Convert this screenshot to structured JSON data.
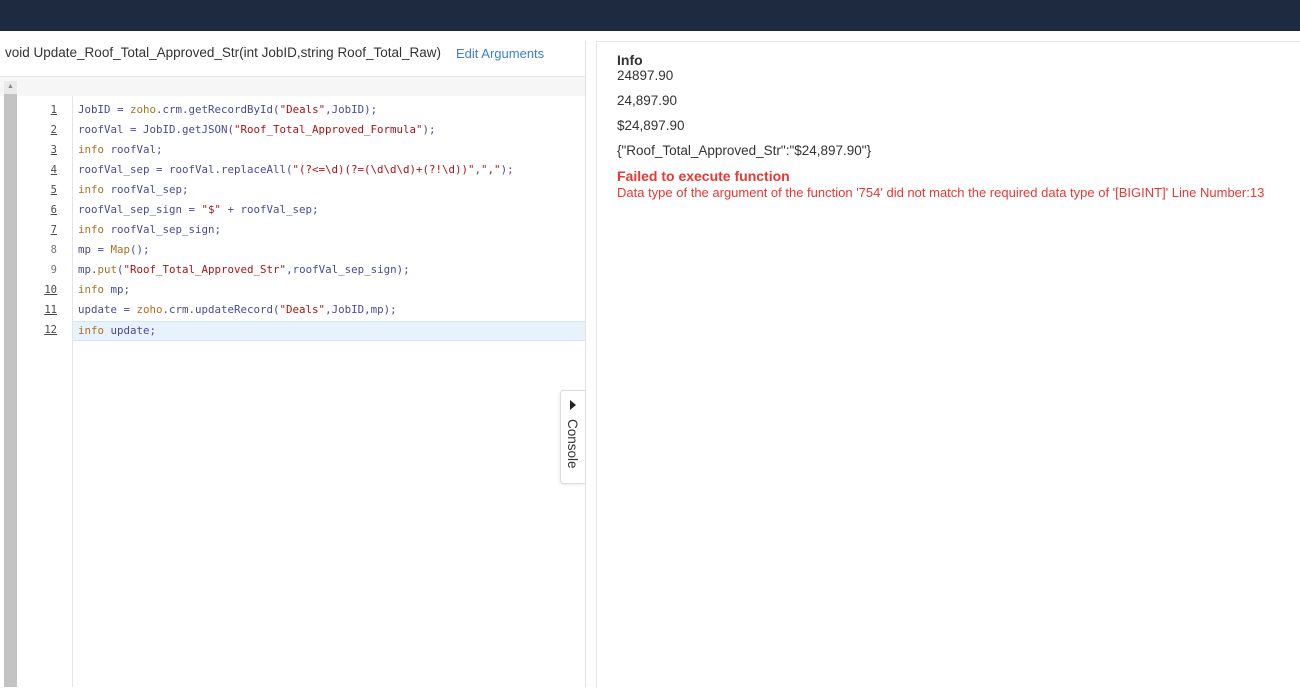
{
  "editor": {
    "signature": "void Update_Roof_Total_Approved_Str(int JobID,string Roof_Total_Raw)",
    "edit_arguments": "Edit Arguments",
    "line_numbers": [
      "1",
      "2",
      "3",
      "4",
      "5",
      "6",
      "7",
      "8",
      "9",
      "10",
      "11",
      "12"
    ],
    "code": [
      [
        {
          "t": "JobID",
          "c": "op"
        },
        {
          "t": " = ",
          "c": "op"
        },
        {
          "t": "zoho",
          "c": "kw"
        },
        {
          "t": ".crm.getRecordById(",
          "c": "op"
        },
        {
          "t": "\"Deals\"",
          "c": "str"
        },
        {
          "t": ",JobID);",
          "c": "op"
        }
      ],
      [
        {
          "t": "roofVal = JobID.getJSON(",
          "c": "op"
        },
        {
          "t": "\"Roof_Total_Approved_Formula\"",
          "c": "str"
        },
        {
          "t": ");",
          "c": "op"
        }
      ],
      [
        {
          "t": "info",
          "c": "kw"
        },
        {
          "t": " roofVal;",
          "c": "op"
        }
      ],
      [
        {
          "t": "roofVal_sep = roofVal.replaceAll(",
          "c": "op"
        },
        {
          "t": "\"(?<=\\d)(?=(\\d\\d\\d)+(?!\\d))\"",
          "c": "str"
        },
        {
          "t": ",",
          "c": "op"
        },
        {
          "t": "\",\"",
          "c": "str"
        },
        {
          "t": ");",
          "c": "op"
        }
      ],
      [
        {
          "t": "info",
          "c": "kw"
        },
        {
          "t": " roofVal_sep;",
          "c": "op"
        }
      ],
      [
        {
          "t": "roofVal_sep_sign = ",
          "c": "op"
        },
        {
          "t": "\"$\"",
          "c": "str"
        },
        {
          "t": " + roofVal_sep;",
          "c": "op"
        }
      ],
      [
        {
          "t": "info",
          "c": "kw"
        },
        {
          "t": " roofVal_sep_sign;",
          "c": "op"
        }
      ],
      [
        {
          "t": "mp = ",
          "c": "op"
        },
        {
          "t": "Map",
          "c": "kw"
        },
        {
          "t": "();",
          "c": "op"
        }
      ],
      [
        {
          "t": "mp.",
          "c": "op"
        },
        {
          "t": "put",
          "c": "kw"
        },
        {
          "t": "(",
          "c": "op"
        },
        {
          "t": "\"Roof_Total_Approved_Str\"",
          "c": "str"
        },
        {
          "t": ",roofVal_sep_sign);",
          "c": "op"
        }
      ],
      [
        {
          "t": "info",
          "c": "kw"
        },
        {
          "t": " mp;",
          "c": "op"
        }
      ],
      [
        {
          "t": "update = ",
          "c": "op"
        },
        {
          "t": "zoho",
          "c": "kw"
        },
        {
          "t": ".crm.updateRecord(",
          "c": "op"
        },
        {
          "t": "\"Deals\"",
          "c": "str"
        },
        {
          "t": ",JobID,mp);",
          "c": "op"
        }
      ],
      [
        {
          "t": "info",
          "c": "kw"
        },
        {
          "t": " update;",
          "c": "op"
        }
      ]
    ],
    "console_tab": "Console"
  },
  "output": {
    "title": "Info",
    "lines": [
      "24897.90",
      "24,897.90",
      "$24,897.90",
      "{\"Roof_Total_Approved_Str\":\"$24,897.90\"}"
    ],
    "error_title": "Failed to execute function",
    "error_message": "Data type of the argument of the function '754' did not match the required data type of '[BIGINT]' Line Number:13"
  },
  "colors": {
    "topbar": "#1e2a40",
    "link": "#3b7fd6",
    "error": "#e53935",
    "string": "#b01212",
    "keyword": "#b07020",
    "identifier": "#4a4a9c"
  }
}
